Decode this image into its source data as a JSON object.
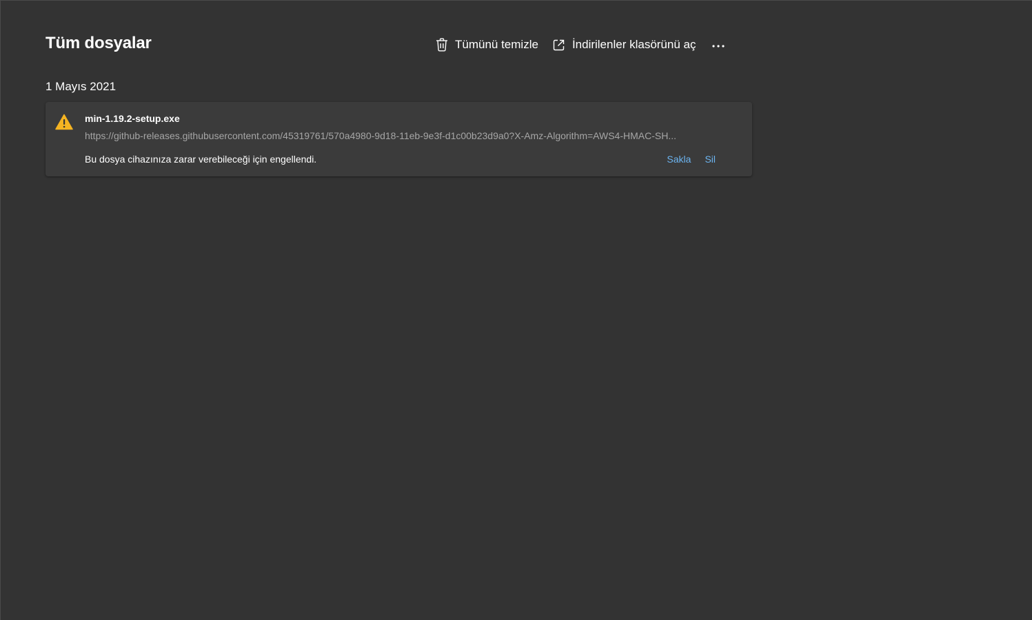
{
  "header": {
    "title": "Tüm dosyalar",
    "clear_all_label": "Tümünü temizle",
    "open_folder_label": "İndirilenler klasörünü aç",
    "more_icon": "more-horizontal-icon"
  },
  "groups": [
    {
      "date": "1 Mayıs 2021",
      "items": [
        {
          "file_name": "min-1.19.2-setup.exe",
          "url": "https://github-releases.githubusercontent.com/45319761/570a4980-9d18-11eb-9e3f-d1c00b23d9a0?X-Amz-Algorithm=AWS4-HMAC-SH...",
          "status": "Bu dosya cihazınıza zarar verebileceği için engellendi.",
          "keep_label": "Sakla",
          "delete_label": "Sil",
          "icon": "warning-icon"
        }
      ]
    }
  ],
  "colors": {
    "background": "#333333",
    "card": "#3b3b3b",
    "link": "#6cb4f0",
    "warning": "#f5b422",
    "muted_text": "#a6a6a6"
  }
}
